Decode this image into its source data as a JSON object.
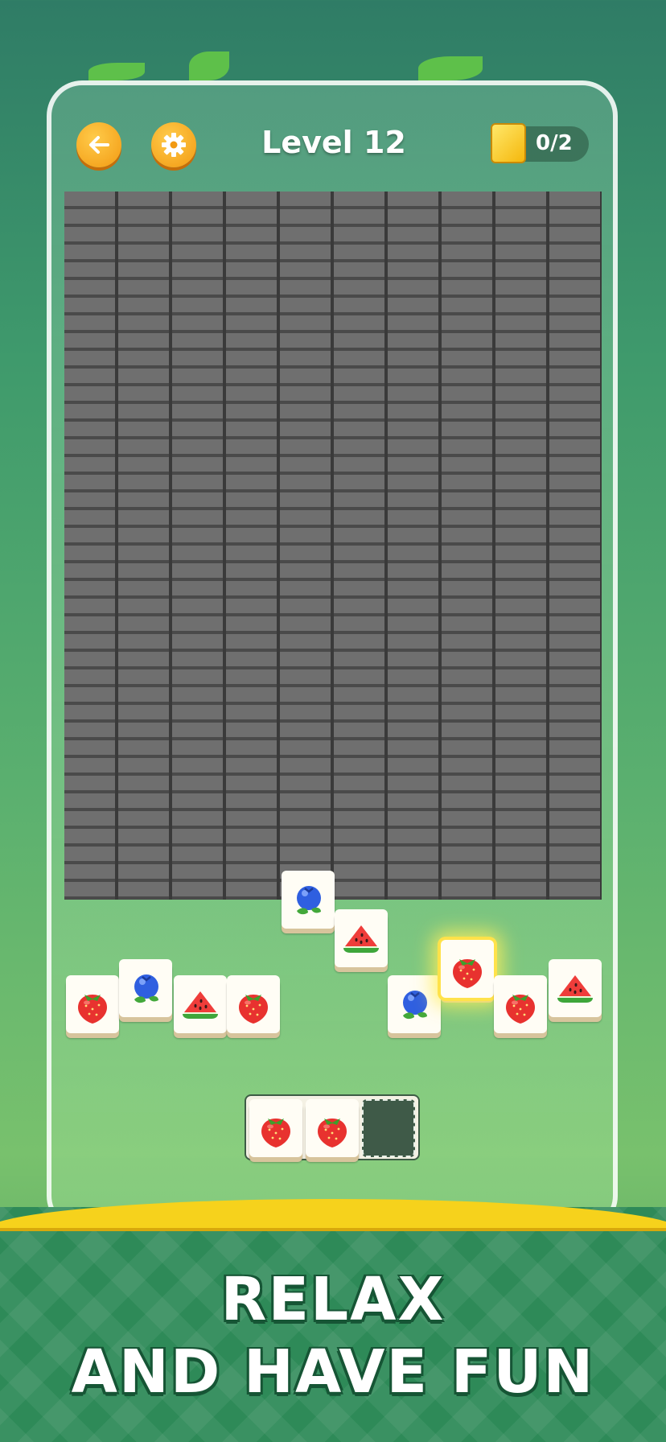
{
  "header": {
    "level_title": "Level 12",
    "goal_count": "0/2",
    "back_icon": "arrow-left-icon",
    "settings_icon": "gear-icon"
  },
  "colors": {
    "accent": "#f5a623",
    "tile_face": "#fffdf5",
    "banner": "#2e8a58",
    "banner_edge": "#f6d21c"
  },
  "tiles": [
    {
      "fruit": "strawberry"
    },
    {
      "fruit": "blueberry"
    },
    {
      "fruit": "watermelon"
    },
    {
      "fruit": "strawberry"
    },
    {
      "fruit": "blueberry"
    },
    {
      "fruit": "watermelon"
    },
    {
      "fruit": "blueberry"
    },
    {
      "fruit": "strawberry",
      "highlighted": true
    },
    {
      "fruit": "strawberry"
    },
    {
      "fruit": "watermelon"
    }
  ],
  "tray": {
    "slots": [
      "strawberry",
      "strawberry",
      "empty"
    ]
  },
  "slogan": {
    "line1": "RELAX",
    "line2": "AND HAVE FUN"
  }
}
